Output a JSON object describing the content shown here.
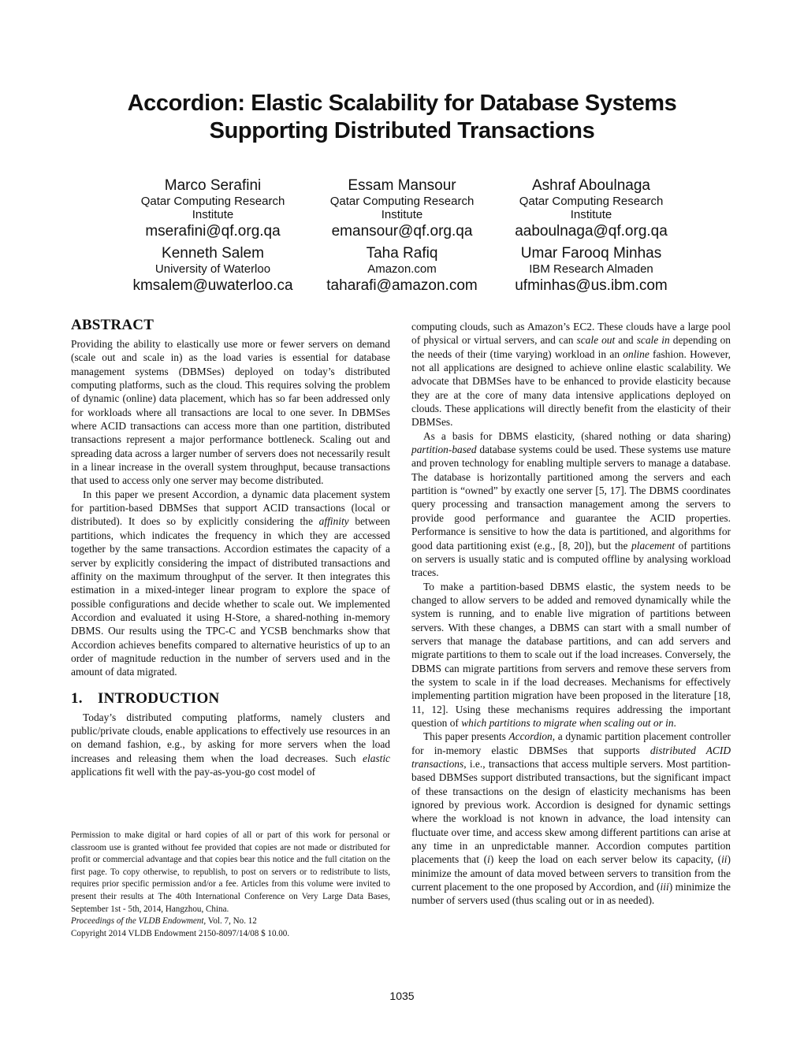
{
  "paper": {
    "title_line1": "Accordion: Elastic Scalability for Database Systems",
    "title_line2": "Supporting Distributed Transactions",
    "authors": [
      {
        "name": "Marco Serafini",
        "affiliation_line1": "Qatar Computing Research",
        "affiliation_line2": "Institute",
        "email": "mserafini@qf.org.qa"
      },
      {
        "name": "Essam Mansour",
        "affiliation_line1": "Qatar Computing Research",
        "affiliation_line2": "Institute",
        "email": "emansour@qf.org.qa"
      },
      {
        "name": "Ashraf Aboulnaga",
        "affiliation_line1": "Qatar Computing Research",
        "affiliation_line2": "Institute",
        "email": "aaboulnaga@qf.org.qa"
      },
      {
        "name": "Kenneth Salem",
        "affiliation_line1": "University of Waterloo",
        "affiliation_line2": "",
        "email": "kmsalem@uwaterloo.ca"
      },
      {
        "name": "Taha Rafiq",
        "affiliation_line1": "Amazon.com",
        "affiliation_line2": "",
        "email": "taharafi@amazon.com"
      },
      {
        "name": "Umar Farooq Minhas",
        "affiliation_line1": "IBM Research Almaden",
        "affiliation_line2": "",
        "email": "ufminhas@us.ibm.com"
      }
    ],
    "abstract": {
      "heading": "ABSTRACT",
      "p1": "Providing the ability to elastically use more or fewer servers on demand (scale out and scale in) as the load varies is essential for database management systems (DBMSes) deployed on today’s distributed computing platforms, such as the cloud. This requires solving the problem of dynamic (online) data placement, which has so far been addressed only for workloads where all transactions are local to one sever. In DBMSes where ACID transactions can access more than one partition, distributed transactions represent a major performance bottleneck. Scaling out and spreading data across a larger number of servers does not necessarily result in a linear increase in the overall system throughput, because transactions that used to access only one server may become distributed.",
      "p2_a": "In this paper we present Accordion, a dynamic data placement system for partition-based DBMSes that support ACID transactions (local or distributed). It does so by explicitly considering the ",
      "p2_em": "affinity",
      "p2_b": " between partitions, which indicates the frequency in which they are accessed together by the same transactions. Accordion estimates the capacity of a server by explicitly considering the impact of distributed transactions and affinity on the maximum throughput of the server. It then integrates this estimation in a mixed-integer linear program to explore the space of possible configurations and decide whether to scale out. We implemented Accordion and evaluated it using H-Store, a shared-nothing in-memory DBMS. Our results using the TPC-C and YCSB benchmarks show that Accordion achieves benefits compared to alternative heuristics of up to an order of magnitude reduction in the number of servers used and in the amount of data migrated."
    },
    "introduction": {
      "number": "1.",
      "heading": "INTRODUCTION",
      "p1_a": "Today’s distributed computing platforms, namely clusters and public/private clouds, enable applications to effectively use resources in an on demand fashion, e.g., by asking for more servers when the load increases and releasing them when the load decreases. Such ",
      "p1_em": "elastic",
      "p1_b": " applications fit well with the pay-as-you-go cost model of ",
      "p1_cont_a": "computing clouds, such as Amazon’s EC2. These clouds have a large pool of physical or virtual servers, and can ",
      "p1_cont_em1": "scale out",
      "p1_cont_b": " and ",
      "p1_cont_em2": "scale in",
      "p1_cont_c": " depending on the needs of their (time varying) workload in an ",
      "p1_cont_em3": "online",
      "p1_cont_d": " fashion. However, not all applications are designed to achieve online elastic scalability. We advocate that DBMSes have to be enhanced to provide elasticity because they are at the core of many data intensive applications deployed on clouds. These applications will directly benefit from the elasticity of their DBMSes.",
      "p2_a": "As a basis for DBMS elasticity, (shared nothing or data sharing) ",
      "p2_em1": "partition-based",
      "p2_b": " database systems could be used. These systems use mature and proven technology for enabling multiple servers to manage a database. The database is horizontally partitioned among the servers and each partition is “owned” by exactly one server [5, 17]. The DBMS coordinates query processing and transaction management among the servers to provide good performance and guarantee the ACID properties. Performance is sensitive to how the data is partitioned, and algorithms for good data partitioning exist (e.g., [8, 20]), but the ",
      "p2_em2": "placement",
      "p2_c": " of partitions on servers is usually static and is computed offline by analysing workload traces.",
      "p3_a": "To make a partition-based DBMS elastic, the system needs to be changed to allow servers to be added and removed dynamically while the system is running, and to enable live migration of partitions between servers. With these changes, a DBMS can start with a small number of servers that manage the database partitions, and can add servers and migrate partitions to them to scale out if the load increases. Conversely, the DBMS can migrate partitions from servers and remove these servers from the system to scale in if the load decreases. Mechanisms for effectively implementing partition migration have been proposed in the literature [18, 11, 12]. Using these mechanisms requires addressing the important question of ",
      "p3_em": "which partitions to migrate when scaling out or in",
      "p3_b": ".",
      "p4_a": "This paper presents ",
      "p4_em1": "Accordion",
      "p4_b": ", a dynamic partition placement controller for in-memory elastic DBMSes that supports ",
      "p4_em2": "distributed ACID transactions",
      "p4_c": ", i.e., transactions that access multiple servers. Most partition-based DBMSes support distributed transactions, but the significant impact of these transactions on the design of elasticity mechanisms has been ignored by previous work. Accordion is designed for dynamic settings where the workload is not known in advance, the load intensity can fluctuate over time, and access skew among different partitions can arise at any time in an unpredictable manner. Accordion computes partition placements that (",
      "p4_em3": "i",
      "p4_d": ") keep the load on each server below its capacity, (",
      "p4_em4": "ii",
      "p4_e": ") minimize the amount of data moved between servers to transition from the current placement to the one proposed by Accordion, and (",
      "p4_em5": "iii",
      "p4_f": ") minimize the number of servers used (thus scaling out or in as needed)."
    },
    "footnote": {
      "permission": "Permission to make digital or hard copies of all or part of this work for personal or classroom use is granted without fee provided that copies are not made or distributed for profit or commercial advantage and that copies bear this notice and the full citation on the first page. To copy otherwise, to republish, to post on servers or to redistribute to lists, requires prior specific permission and/or a fee. Articles from this volume were invited to present their results at The 40th International Conference on Very Large Data Bases, September 1st - 5th, 2014, Hangzhou, China.",
      "proceedings_em": "Proceedings of the VLDB Endowment,",
      "proceedings_rest": " Vol. 7, No. 12",
      "copyright": "Copyright 2014 VLDB Endowment 2150-8097/14/08 $ 10.00."
    },
    "page_number": "1035"
  }
}
